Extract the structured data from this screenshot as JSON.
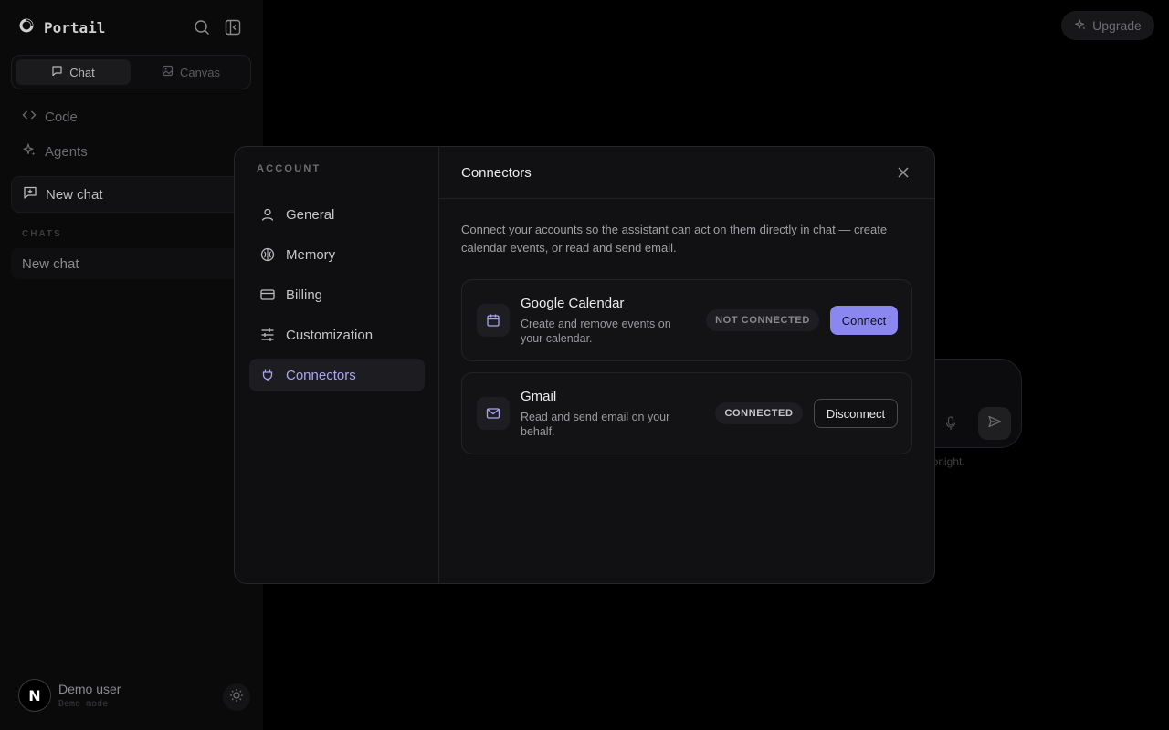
{
  "app": {
    "brand": "Portail",
    "brand_icon": "portail-logo-icon"
  },
  "sidebar": {
    "tabs": [
      {
        "label": "Chat",
        "icon": "chat-bubble-icon",
        "active": true
      },
      {
        "label": "Canvas",
        "icon": "image-icon",
        "active": false
      }
    ],
    "nav": [
      {
        "label": "Code",
        "icon": "code-brackets-icon"
      },
      {
        "label": "Agents",
        "icon": "sparkles-icon"
      }
    ],
    "new_chat_label": "New chat",
    "chats_heading": "CHATS",
    "chats": [
      "New chat"
    ],
    "user": {
      "name": "Demo user",
      "subtitle": "Demo mode",
      "avatar_letter": "N"
    }
  },
  "header": {
    "upgrade_label": "Upgrade"
  },
  "composer": {
    "hint_fragment": "r tonight."
  },
  "modal": {
    "nav_heading": "ACCOUNT",
    "nav": [
      {
        "label": "General",
        "icon": "user-icon",
        "active": false
      },
      {
        "label": "Memory",
        "icon": "brain-icon",
        "active": false
      },
      {
        "label": "Billing",
        "icon": "credit-card-icon",
        "active": false
      },
      {
        "label": "Customization",
        "icon": "sliders-icon",
        "active": false
      },
      {
        "label": "Connectors",
        "icon": "plug-icon",
        "active": true
      }
    ],
    "title": "Connectors",
    "intro": "Connect your accounts so the assistant can act on them directly in chat — create calendar events, or read and send email.",
    "connectors": [
      {
        "name": "Google Calendar",
        "description": "Create and remove events on your calendar.",
        "icon": "calendar-icon",
        "status": "NOT CONNECTED",
        "action": "Connect"
      },
      {
        "name": "Gmail",
        "description": "Read and send email on your behalf.",
        "icon": "mail-icon",
        "status": "CONNECTED",
        "action": "Disconnect"
      }
    ]
  },
  "colors": {
    "accent": "#8b87f0",
    "accent_text": "#a8a6f0",
    "modal_bg": "#111113",
    "page_bg": "#000000"
  }
}
